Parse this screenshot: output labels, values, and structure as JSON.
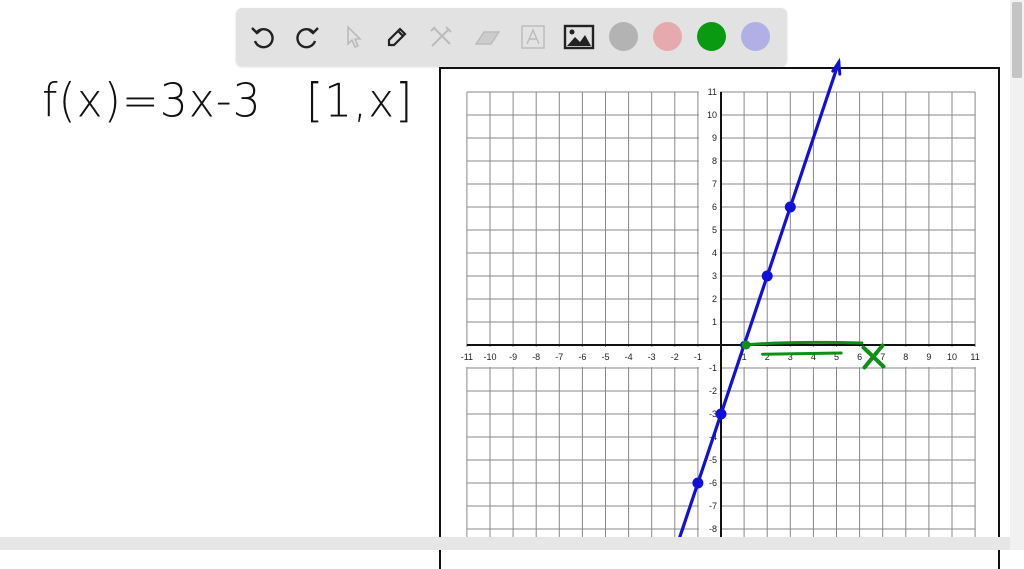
{
  "toolbar": {
    "tools": [
      {
        "name": "undo",
        "icon": "undo-icon",
        "enabled": true
      },
      {
        "name": "redo",
        "icon": "redo-icon",
        "enabled": true
      },
      {
        "name": "select",
        "icon": "pointer-icon",
        "enabled": false
      },
      {
        "name": "pen",
        "icon": "pen-icon",
        "enabled": true
      },
      {
        "name": "tools",
        "icon": "crossed-tools-icon",
        "enabled": false
      },
      {
        "name": "eraser",
        "icon": "eraser-icon",
        "enabled": false
      },
      {
        "name": "text",
        "icon": "text-box-icon",
        "enabled": false
      },
      {
        "name": "image",
        "icon": "image-icon",
        "enabled": true
      }
    ],
    "colors": [
      "#b3b3b3",
      "#e6a9ae",
      "#0a9a12",
      "#b0b0e6"
    ],
    "selected_color": "#0a9a12"
  },
  "handwriting": {
    "function": "f(x)=3x-3",
    "interval": "[1,x]"
  },
  "chart_data": {
    "type": "line",
    "title": "",
    "xlabel": "",
    "ylabel": "",
    "xlim": [
      -11,
      11
    ],
    "ylim": [
      -8,
      11
    ],
    "grid": true,
    "x_ticks": [
      "-11",
      "-10",
      "-9",
      "-8",
      "-7",
      "-6",
      "-5",
      "-4",
      "-3",
      "-2",
      "-1",
      "1",
      "2",
      "3",
      "4",
      "5",
      "6",
      "7",
      "8",
      "9",
      "10",
      "11"
    ],
    "y_ticks": [
      "11",
      "10",
      "9",
      "8",
      "7",
      "6",
      "5",
      "4",
      "3",
      "2",
      "1",
      "-1",
      "-2",
      "-3",
      "-4",
      "-5",
      "-6",
      "-7",
      "-8"
    ],
    "series": [
      {
        "name": "f(x)=3x-3",
        "color": "#1010d8",
        "x": [
          -2.2,
          5.1
        ],
        "y": [
          -9.6,
          12.3
        ],
        "points": [
          [
            -1,
            -6
          ],
          [
            0,
            -3
          ],
          [
            1,
            0
          ],
          [
            2,
            3
          ],
          [
            3,
            6
          ]
        ],
        "arrows": "both"
      },
      {
        "name": "domain [1,x)",
        "color": "#0f8f15",
        "x": [
          1,
          6.1
        ],
        "y": [
          0,
          0
        ],
        "start_point": [
          1,
          0
        ],
        "underline": [
          [
            1.8,
            -0.4
          ],
          [
            5.2,
            -0.35
          ]
        ],
        "cross_mark": [
          6.6,
          -0.5
        ]
      }
    ]
  }
}
